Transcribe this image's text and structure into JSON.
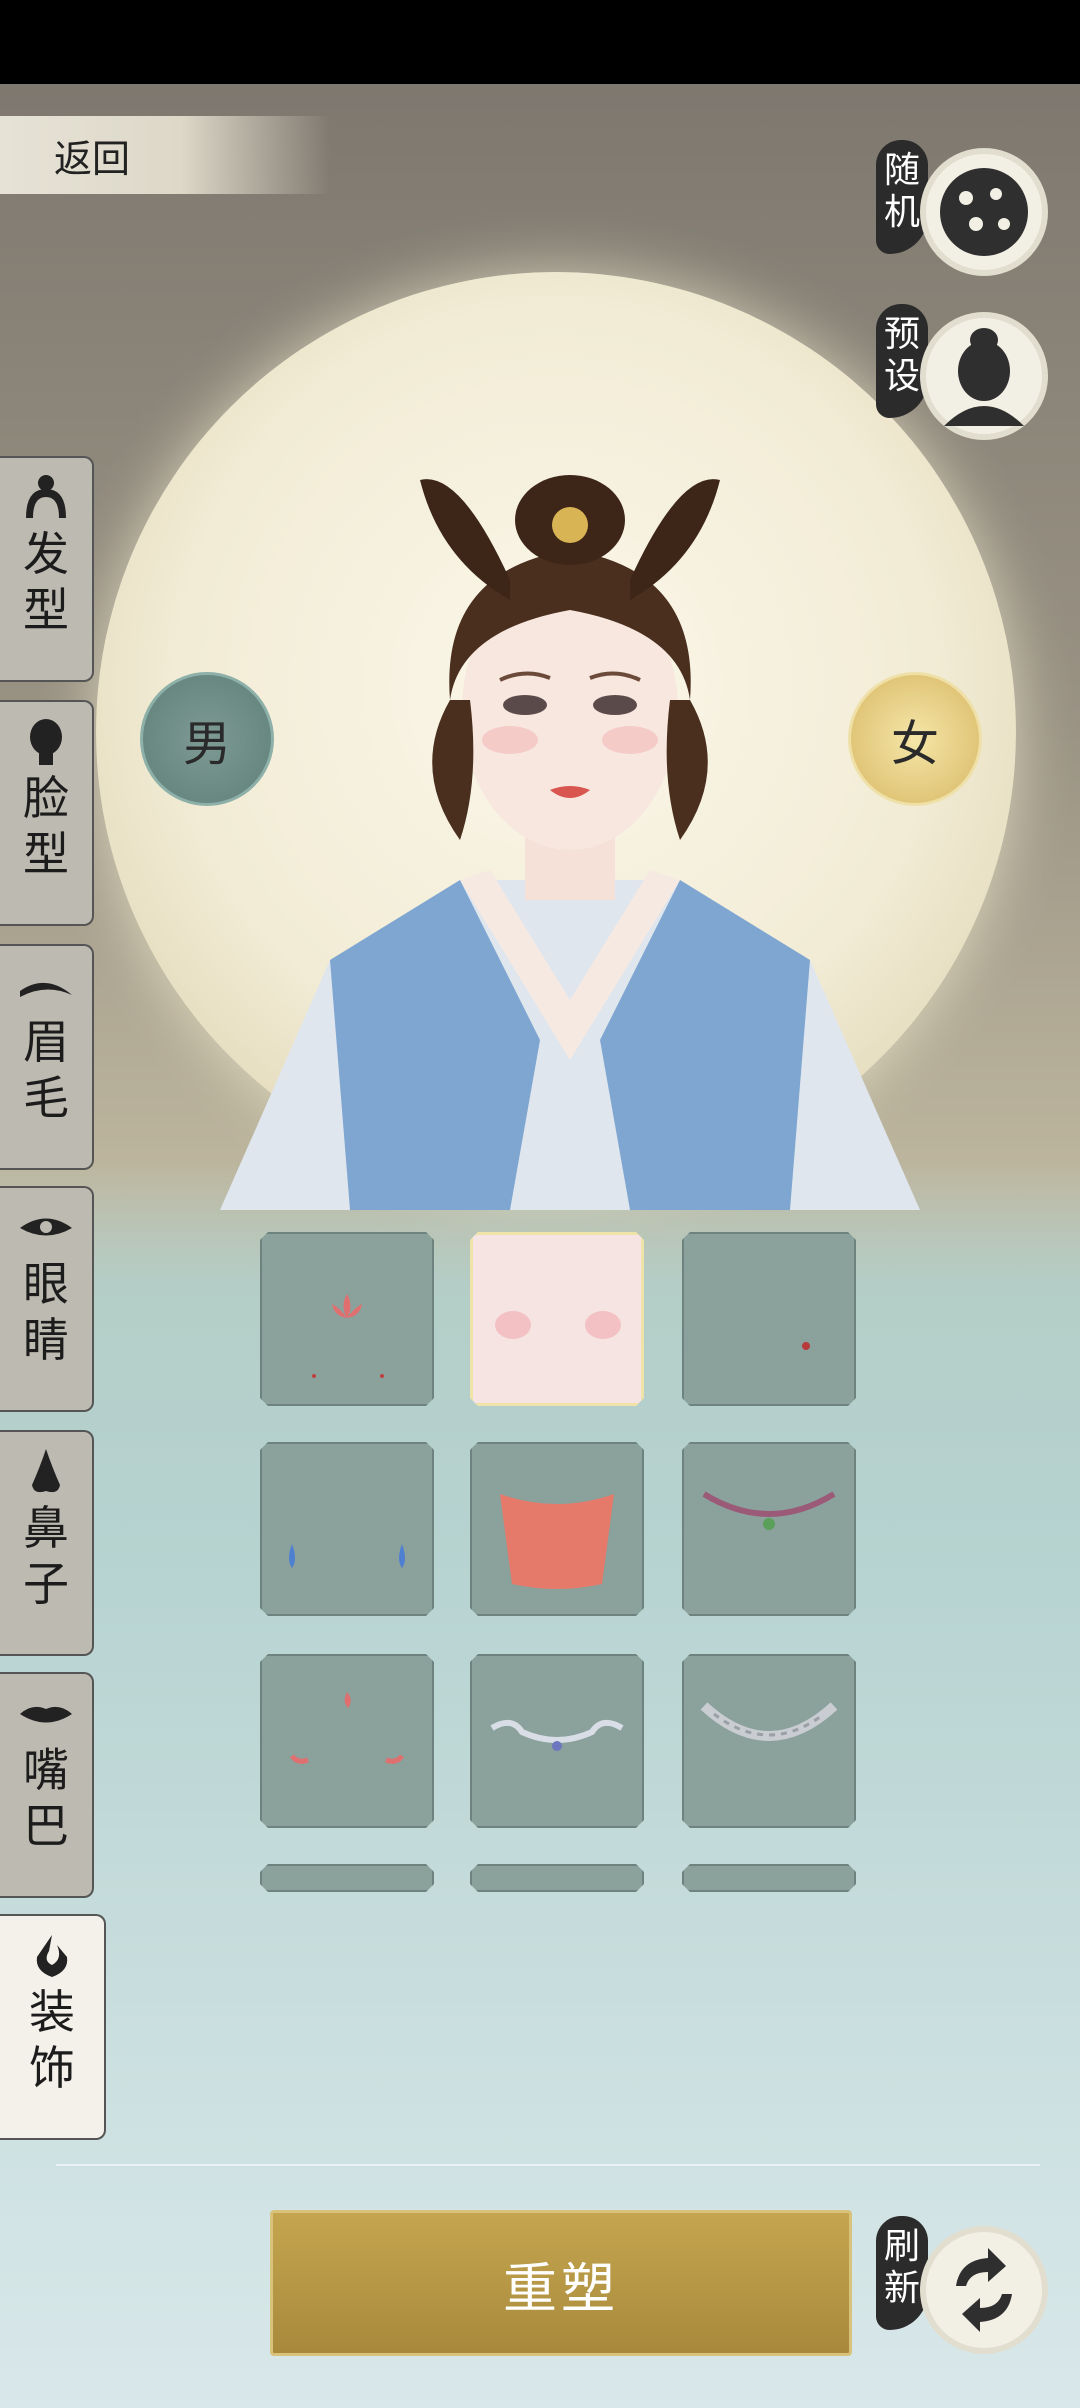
{
  "nav": {
    "back_label": "返回"
  },
  "gender": {
    "male_label": "男",
    "female_label": "女"
  },
  "actions": {
    "random_label": "随机",
    "preset_label": "预设",
    "refresh_label": "刷新",
    "remodel_label": "重塑"
  },
  "categories": [
    {
      "label": "发型",
      "icon": "hair-bun-icon"
    },
    {
      "label": "脸型",
      "icon": "face-head-icon"
    },
    {
      "label": "眉毛",
      "icon": "eyebrow-icon"
    },
    {
      "label": "眼睛",
      "icon": "eye-icon"
    },
    {
      "label": "鼻子",
      "icon": "nose-icon"
    },
    {
      "label": "嘴巴",
      "icon": "lips-icon"
    },
    {
      "label": "装饰",
      "icon": "ornament-icon",
      "active": true
    }
  ],
  "accessories": [
    {
      "name": "lotus-forehead-mark",
      "selected": false
    },
    {
      "name": "rosy-cheek-blush",
      "selected": true
    },
    {
      "name": "beauty-mark-dot",
      "selected": false
    },
    {
      "name": "blue-drop-earrings",
      "selected": false
    },
    {
      "name": "red-veil",
      "selected": false
    },
    {
      "name": "jade-necklace",
      "selected": false
    },
    {
      "name": "red-petal-marks",
      "selected": false
    },
    {
      "name": "silver-necklace",
      "selected": false
    },
    {
      "name": "lattice-choker",
      "selected": false
    }
  ],
  "colors": {
    "accent_gold": "#b39544",
    "panel_teal": "#8aa19c",
    "ink": "#2b2b2b"
  }
}
